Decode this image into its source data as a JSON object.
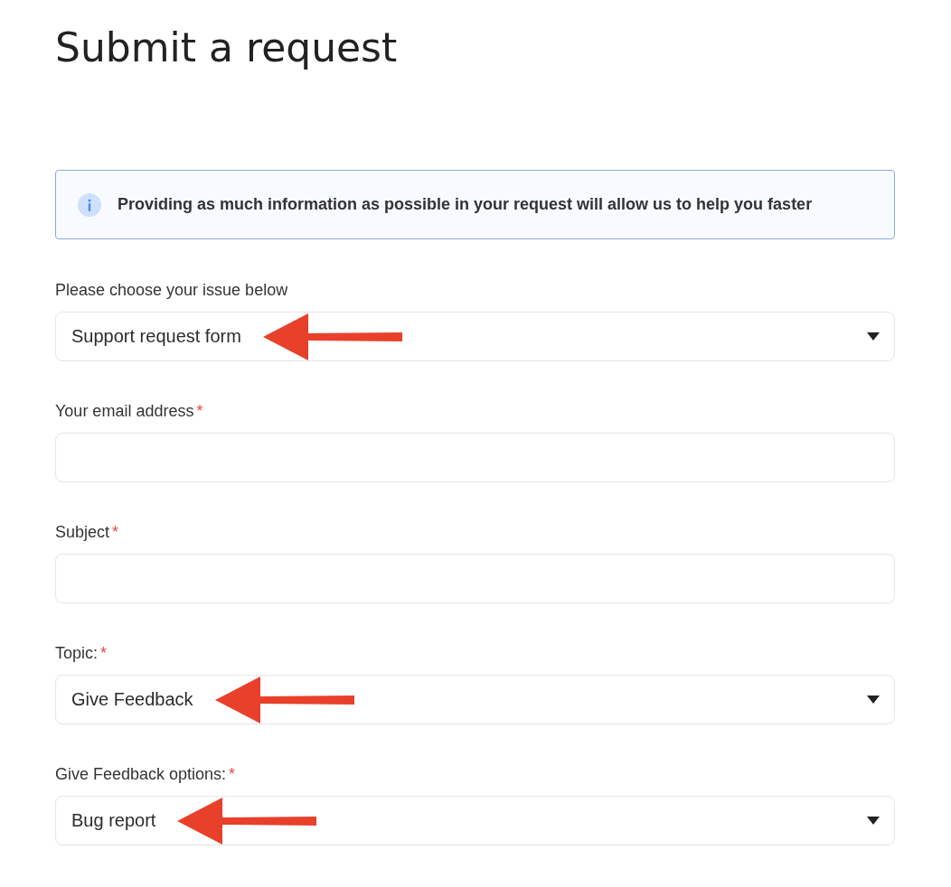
{
  "title": "Submit a request",
  "notice": {
    "text": "Providing as much information as possible in your request will allow us to help you faster"
  },
  "fields": [
    {
      "kind": "select",
      "label": "Please choose your issue below",
      "value": "Support request form",
      "arrow": true
    },
    {
      "kind": "text",
      "label": "Your email address",
      "required_mark": "*"
    },
    {
      "kind": "text",
      "label": "Subject",
      "required_mark": "*"
    },
    {
      "kind": "select",
      "label": "Topic:",
      "required_mark": "*",
      "value": "Give Feedback",
      "arrow": true
    },
    {
      "kind": "select",
      "label": "Give Feedback options:",
      "required_mark": "*",
      "value": "Bug report",
      "arrow": true
    }
  ]
}
